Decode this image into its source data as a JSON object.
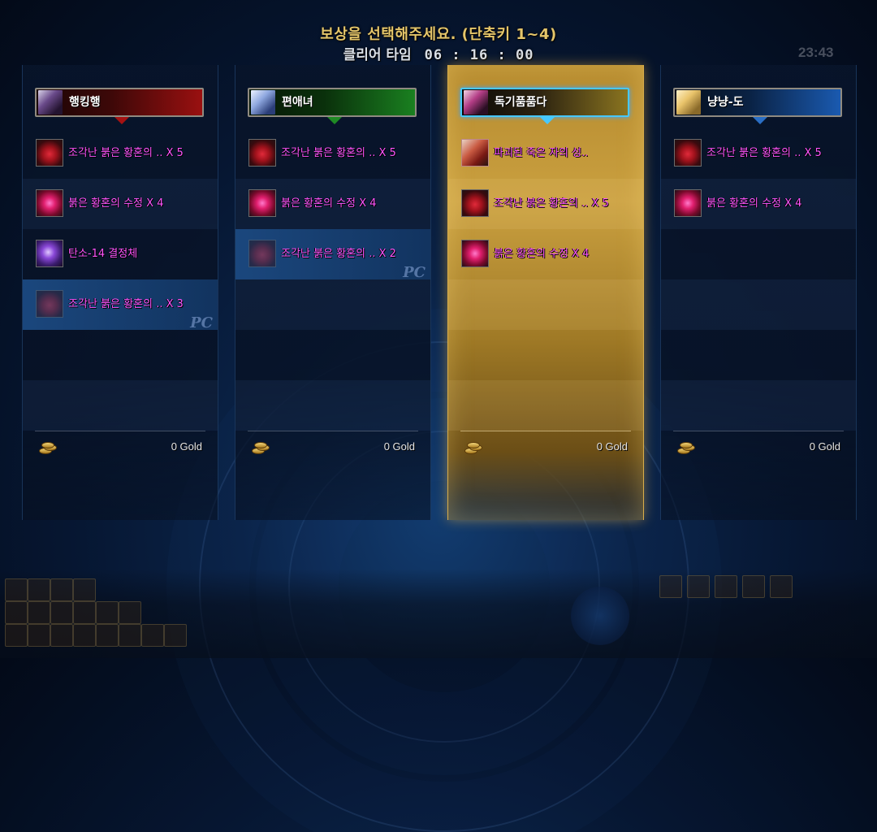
{
  "header": {
    "title": "보상을 선택해주세요. (단축키 1~4)",
    "clear_label": "클리어 타임",
    "clear_time": "06 : 16 : 00"
  },
  "hud": {
    "clock": "23:43"
  },
  "colors": {
    "item_text": "#ff55ff",
    "title": "#e4c56a",
    "selected_column": "#caa040",
    "selected_border": "#47c8ff"
  },
  "players": [
    {
      "name": "행킹행",
      "bar_color": "red",
      "selected": false,
      "rewards": [
        {
          "icon": "red-shard-icon",
          "text": "조각난 붉은 황혼의 .. X 5",
          "highlight": false,
          "dim": false
        },
        {
          "icon": "red-crystal-icon",
          "text": "붉은 황혼의 수정 X 4",
          "highlight": false,
          "dim": false
        },
        {
          "icon": "tanso-crystal-icon",
          "text": "탄소-14 결정체",
          "highlight": false,
          "dim": false
        },
        {
          "icon": "red-shard-icon",
          "text": "조각난 붉은 황혼의 .. X 3",
          "highlight": true,
          "dim": true,
          "mark": "PC"
        }
      ],
      "gold": "0 Gold"
    },
    {
      "name": "편애녀",
      "bar_color": "green",
      "selected": false,
      "rewards": [
        {
          "icon": "red-shard-icon",
          "text": "조각난 붉은 황혼의 .. X 5",
          "highlight": false,
          "dim": false
        },
        {
          "icon": "red-crystal-icon",
          "text": "붉은 황혼의 수정 X 4",
          "highlight": false,
          "dim": false
        },
        {
          "icon": "red-shard-icon",
          "text": "조각난 붉은 황혼의 .. X 2",
          "highlight": true,
          "dim": true,
          "mark": "PC"
        }
      ],
      "gold": "0 Gold"
    },
    {
      "name": "독기품품다",
      "bar_color": "gold",
      "selected": true,
      "rewards": [
        {
          "icon": "broken-book-icon",
          "text": "파괴된 죽은 자의 성..",
          "highlight": false,
          "dim": false
        },
        {
          "icon": "red-shard-icon",
          "text": "조각난 붉은 황혼의 .. X 5",
          "highlight": false,
          "dim": false
        },
        {
          "icon": "red-crystal-icon",
          "text": "붉은 황혼의 수정 X 4",
          "highlight": false,
          "dim": false
        }
      ],
      "gold": "0 Gold"
    },
    {
      "name": "냥냥-도",
      "bar_color": "blue",
      "selected": false,
      "rewards": [
        {
          "icon": "red-shard-icon",
          "text": "조각난 붉은 황혼의 .. X 5",
          "highlight": false,
          "dim": false
        },
        {
          "icon": "red-crystal-icon",
          "text": "붉은 황혼의 수정 X 4",
          "highlight": false,
          "dim": false
        }
      ],
      "gold": "0 Gold"
    }
  ]
}
